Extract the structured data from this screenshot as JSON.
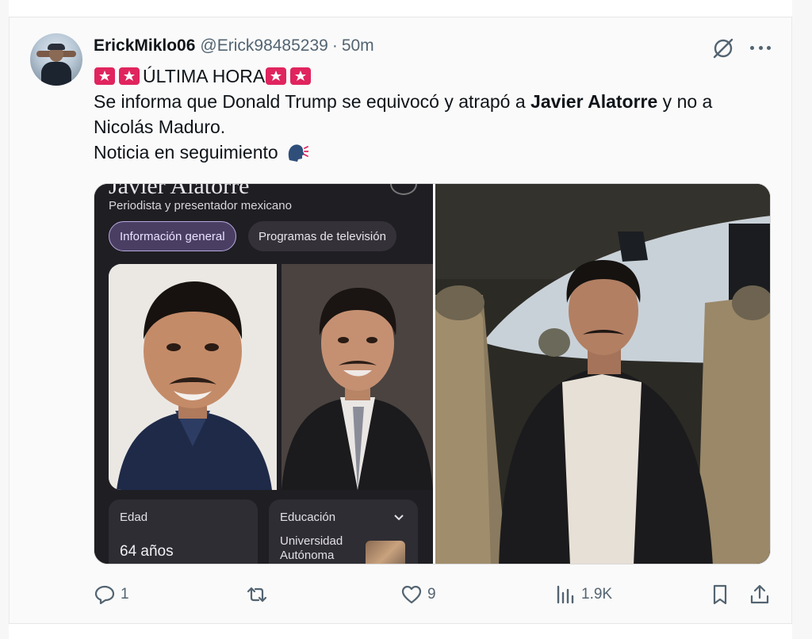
{
  "author": {
    "display_name": "ErickMiklo06",
    "handle": "@Erick98485239",
    "separator": "·",
    "time": "50m"
  },
  "tweet": {
    "headline": "ÚLTIMA HORA",
    "line2_prefix": "Se informa que Donald Trump se equivocó y atrapó a ",
    "line2_bold": "Javier Alatorre",
    "line2_suffix": " y no a",
    "line3": "Nicolás Maduro.",
    "line4": "Noticia en seguimiento"
  },
  "media": {
    "left_panel": {
      "title": "Javier Alatorre",
      "subtitle": "Periodista y presentador mexicano",
      "tabs": [
        "Información general",
        "Programas de televisión"
      ],
      "age_label": "Edad",
      "age_value": "64 años",
      "education_label": "Educación",
      "education_value": "Universidad Autónoma"
    }
  },
  "actions": {
    "replies": "1",
    "retweets": "",
    "likes": "9",
    "views": "1.9K"
  },
  "icons": {
    "header": [
      "grok-icon",
      "more-icon"
    ],
    "actions": [
      "reply-icon",
      "retweet-icon",
      "like-icon",
      "views-icon",
      "bookmark-icon",
      "share-icon"
    ],
    "emoji": [
      "siren-emoji",
      "speaking-head-emoji"
    ]
  },
  "colors": {
    "text_primary": "#0f1419",
    "text_secondary": "#536471",
    "siren_red": "#e0245e",
    "chip_active": "#4a3f63"
  }
}
